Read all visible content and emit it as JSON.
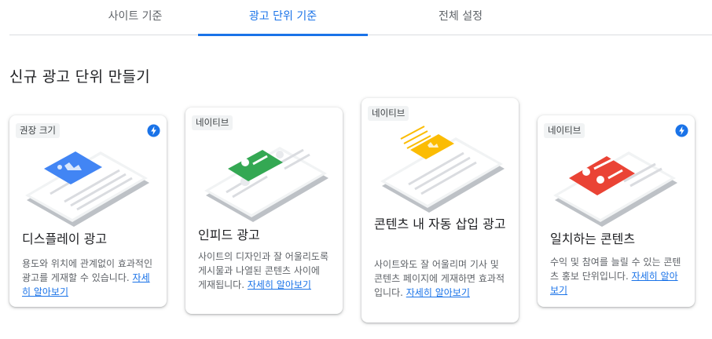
{
  "tabs": [
    {
      "label": "사이트 기준"
    },
    {
      "label": "광고 단위 기준"
    },
    {
      "label": "전체 설정"
    }
  ],
  "active_tab": "광고 단위 기준",
  "section_title": "신규 광고 단위 만들기",
  "cards": [
    {
      "chip": "권장 크기",
      "has_bolt": true,
      "title": "디스플레이 광고",
      "desc": "용도와 위치에 관계없이 효과적인 광고를 게재할 수 있습니다.",
      "link": "자세히 알아보기",
      "color": "#4285f4"
    },
    {
      "chip": "네이티브",
      "has_bolt": false,
      "title": "인피드 광고",
      "desc": "사이트의 디자인과 잘 어울리도록 게시물과 나열된 콘텐츠 사이에 게재됩니다.",
      "link": "자세히 알아보기",
      "color": "#34a853"
    },
    {
      "chip": "네이티브",
      "has_bolt": false,
      "title": "콘텐츠 내 자동 삽입 광고",
      "desc": "사이트와도 잘 어울리며 기사 및 콘텐츠 페이지에 게재하면 효과적입니다.",
      "link": "자세히 알아보기",
      "color": "#fbbc04"
    },
    {
      "chip": "네이티브",
      "has_bolt": true,
      "title": "일치하는 콘텐츠",
      "desc": "수익 및 참여를 늘릴 수 있는 콘텐츠 홍보 단위입니다.",
      "link": "자세히 알아보기",
      "color": "#ea4335"
    }
  ],
  "colors": {
    "accent": "#1a73e8",
    "bolt": "#1a73e8"
  },
  "icons": {
    "bolt": "bolt-icon"
  }
}
